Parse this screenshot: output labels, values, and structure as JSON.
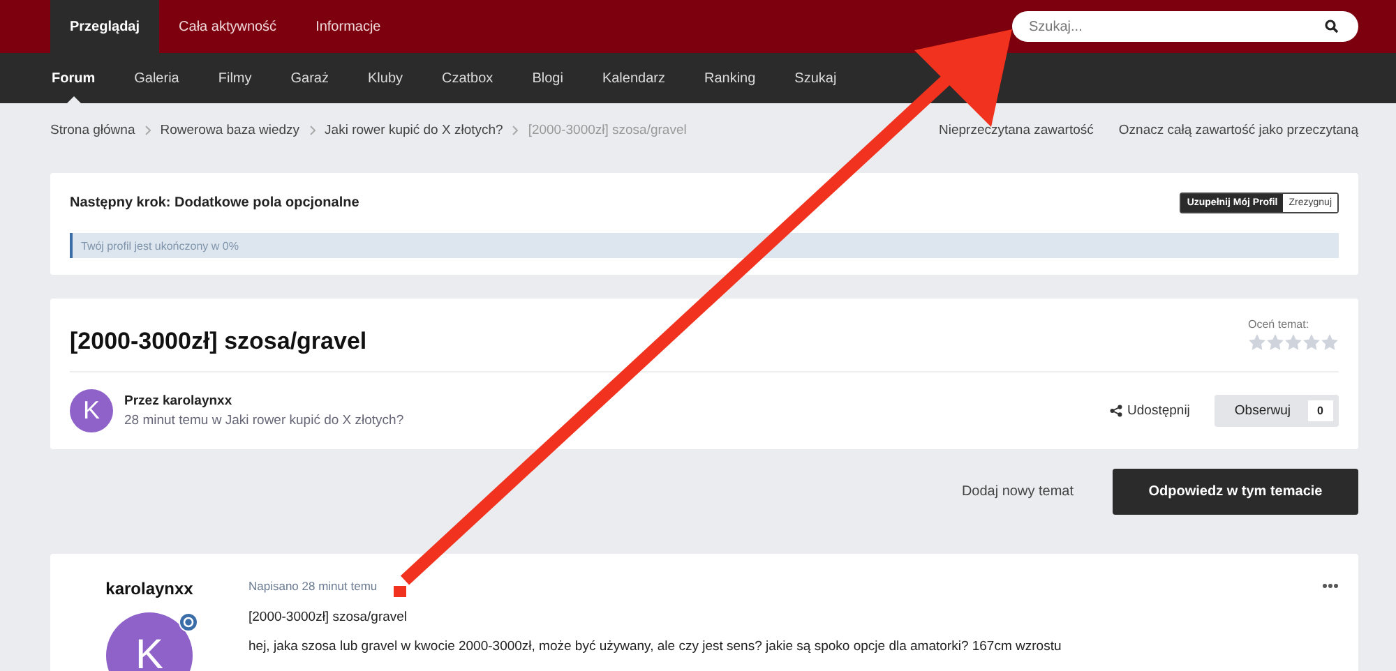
{
  "top_tabs": [
    {
      "label": "Przeglądaj",
      "selected": true
    },
    {
      "label": "Cała aktywność",
      "selected": false
    },
    {
      "label": "Informacje",
      "selected": false
    }
  ],
  "search": {
    "placeholder": "Szukaj..."
  },
  "nav": [
    {
      "label": "Forum",
      "selected": true
    },
    {
      "label": "Galeria",
      "selected": false
    },
    {
      "label": "Filmy",
      "selected": false
    },
    {
      "label": "Garaż",
      "selected": false
    },
    {
      "label": "Kluby",
      "selected": false
    },
    {
      "label": "Czatbox",
      "selected": false
    },
    {
      "label": "Blogi",
      "selected": false
    },
    {
      "label": "Kalendarz",
      "selected": false
    },
    {
      "label": "Ranking",
      "selected": false
    },
    {
      "label": "Szukaj",
      "selected": false
    }
  ],
  "breadcrumbs": [
    {
      "label": "Strona główna",
      "current": false
    },
    {
      "label": "Rowerowa baza wiedzy",
      "current": false
    },
    {
      "label": "Jaki rower kupić do X złotych?",
      "current": false
    },
    {
      "label": "[2000-3000zł] szosa/gravel",
      "current": true
    }
  ],
  "breadcrumb_actions": [
    "Nieprzeczytana zawartość",
    "Oznacz całą zawartość jako przeczytaną"
  ],
  "profile_step": {
    "title": "Następny krok: Dodatkowe pola opcjonalne",
    "buttons": [
      "Uzupełnij Mój Profil",
      "Zrezygnuj"
    ],
    "progress_text": "Twój profil jest ukończony w 0%",
    "level": 0
  },
  "topic": {
    "title": "[2000-3000zł] szosa/gravel",
    "rate_label": "Oceń temat:",
    "stars": 0,
    "avatar_letter": "K",
    "author": "Przez karolaynxx",
    "meta": "28 minut temu w Jaki rower kupić do X złotych?",
    "share": "Udostępnij",
    "follow": "Obserwuj",
    "follow_count": "0"
  },
  "actions": {
    "new_topic": "Dodaj nowy temat",
    "reply": "Odpowiedz w tym temacie"
  },
  "post": {
    "author": "karolaynxx",
    "avatar_letter": "K",
    "date": "Napisano 28 minut temu",
    "title": "[2000-3000zł] szosa/gravel",
    "body": "hej, jaka szosa lub gravel w kwocie 2000-3000zł, może być używany, ale czy jest sens? jakie są spoko opcje dla amatorki? 167cm wzrostu"
  }
}
